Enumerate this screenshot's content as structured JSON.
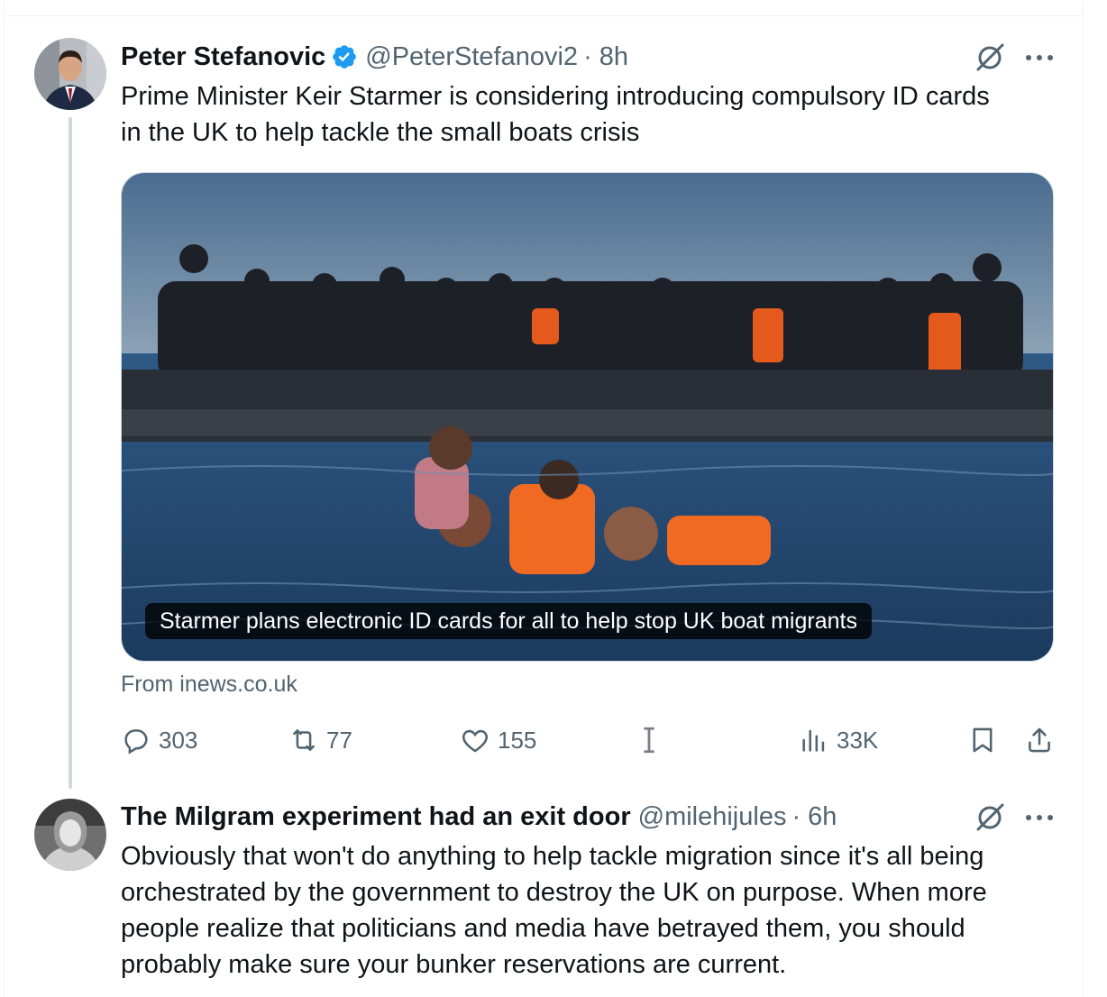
{
  "tweet1": {
    "author_name": "Peter Stefanovic",
    "handle": "@PeterStefanovi2",
    "time": "· 8h",
    "text_line1": "Prime Minister Keir Starmer is considering introducing compulsory ID cards",
    "text_line2": "in the UK to help tackle the small boats crisis",
    "card": {
      "headline": "Starmer plans electronic ID cards for all to help stop UK boat migrants",
      "source": "From inews.co.uk"
    },
    "actions": {
      "replies": "303",
      "reposts": "77",
      "likes": "155",
      "views": "33K"
    }
  },
  "tweet2": {
    "author_name": "The Milgram experiment had an exit door",
    "handle": "@milehijules",
    "time": "· 6h",
    "text_line1": "Obviously that won't do anything to help tackle migration since it's all being",
    "text_line2": "orchestrated by the government to destroy the UK on purpose. When more",
    "text_line3": "people realize that politicians and media have betrayed them, you should",
    "text_line4": "probably make sure your bunker reservations are current."
  },
  "colors": {
    "text": "#0f1419",
    "secondary": "#536471",
    "verified": "#1d9bf0",
    "border": "#cfd9de"
  }
}
